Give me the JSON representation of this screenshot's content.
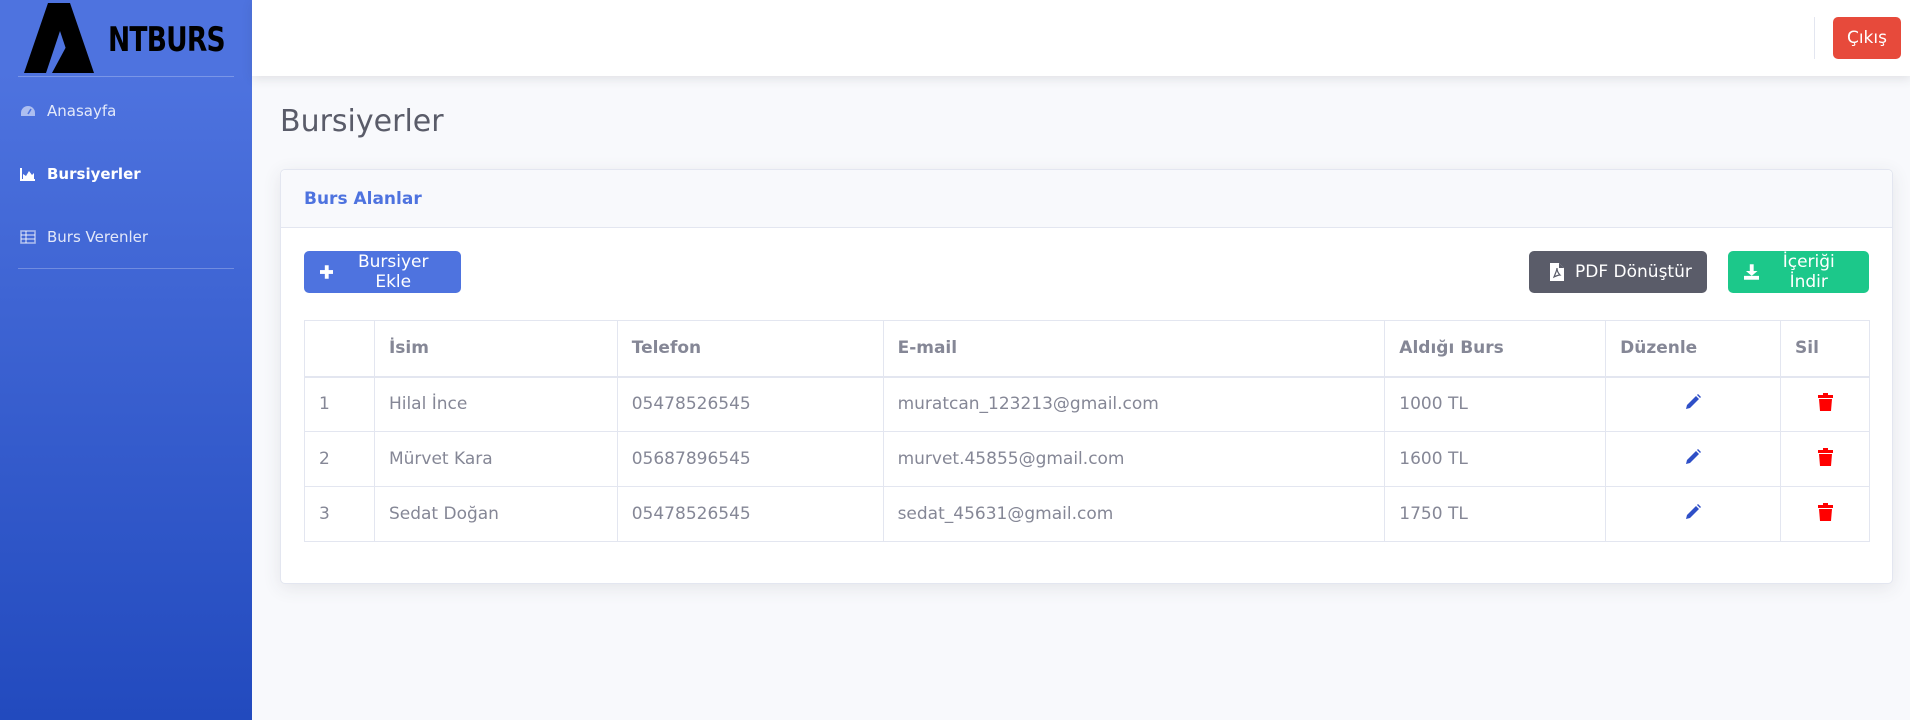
{
  "brand": {
    "text": "NTBURS"
  },
  "sidebar": {
    "items": [
      {
        "label": "Anasayfa",
        "icon": "tachometer-icon",
        "active": false
      },
      {
        "label": "Bursiyerler",
        "icon": "chart-area-icon",
        "active": true
      },
      {
        "label": "Burs Verenler",
        "icon": "table-icon",
        "active": false
      }
    ]
  },
  "topbar": {
    "logout_label": "Çıkış"
  },
  "page": {
    "title": "Bursiyerler"
  },
  "card": {
    "title": "Burs Alanlar",
    "add_button": "Bursiyer Ekle",
    "pdf_button": "PDF Dönüştür",
    "download_button": "İçeriği İndir"
  },
  "table": {
    "headers": [
      "",
      "İsim",
      "Telefon",
      "E-mail",
      "Aldığı Burs",
      "Düzenle",
      "Sil"
    ],
    "rows": [
      {
        "no": "1",
        "name": "Hilal İnce",
        "phone": "05478526545",
        "email": "muratcan_123213@gmail.com",
        "burs": "1000 TL"
      },
      {
        "no": "2",
        "name": "Mürvet Kara",
        "phone": "05687896545",
        "email": "murvet.45855@gmail.com",
        "burs": "1600 TL"
      },
      {
        "no": "3",
        "name": "Sedat Doğan",
        "phone": "05478526545",
        "email": "sedat_45631@gmail.com",
        "burs": "1750 TL"
      }
    ]
  },
  "colors": {
    "primary": "#4e73df",
    "danger": "#e74a3b",
    "success": "#1cc88a",
    "dark": "#5a5c69",
    "edit_icon": "#2e4fc7",
    "delete_icon": "#ff0000"
  }
}
